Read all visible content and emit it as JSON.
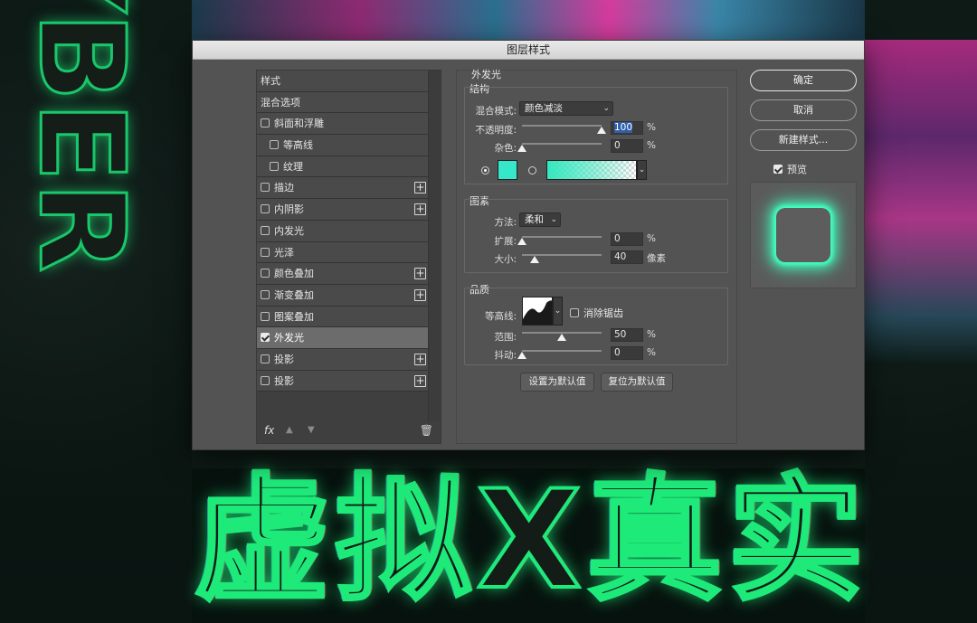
{
  "dialog": {
    "title": "图层样式"
  },
  "left_panel": {
    "items": [
      {
        "label": "样式",
        "type": "header"
      },
      {
        "label": "混合选项",
        "type": "header"
      },
      {
        "label": "斜面和浮雕",
        "type": "check",
        "checked": false,
        "plus": false
      },
      {
        "label": "等高线",
        "type": "subcheck",
        "checked": false,
        "plus": false
      },
      {
        "label": "纹理",
        "type": "subcheck",
        "checked": false,
        "plus": false
      },
      {
        "label": "描边",
        "type": "check",
        "checked": false,
        "plus": true
      },
      {
        "label": "内阴影",
        "type": "check",
        "checked": false,
        "plus": true
      },
      {
        "label": "内发光",
        "type": "check",
        "checked": false,
        "plus": false
      },
      {
        "label": "光泽",
        "type": "check",
        "checked": false,
        "plus": false
      },
      {
        "label": "颜色叠加",
        "type": "check",
        "checked": false,
        "plus": true
      },
      {
        "label": "渐变叠加",
        "type": "check",
        "checked": false,
        "plus": true
      },
      {
        "label": "图案叠加",
        "type": "check",
        "checked": false,
        "plus": false
      },
      {
        "label": "外发光",
        "type": "check",
        "checked": true,
        "plus": false,
        "selected": true
      },
      {
        "label": "投影",
        "type": "check",
        "checked": false,
        "plus": true
      },
      {
        "label": "投影",
        "type": "check",
        "checked": false,
        "plus": true
      }
    ],
    "footer": {
      "fx": "fx"
    }
  },
  "outer_glow": {
    "title": "外发光",
    "structure": {
      "title": "结构",
      "blend_mode_label": "混合模式:",
      "blend_mode_value": "颜色减淡",
      "opacity_label": "不透明度:",
      "opacity_value": "100",
      "opacity_unit": "%",
      "opacity_level": 1.0,
      "noise_label": "杂色:",
      "noise_value": "0",
      "noise_unit": "%",
      "noise_level": 0.0,
      "glow_color": "#34e8c9",
      "color_mode": "solid"
    },
    "elements": {
      "title": "图素",
      "technique_label": "方法:",
      "technique_value": "柔和",
      "spread_label": "扩展:",
      "spread_value": "0",
      "spread_unit": "%",
      "spread_level": 0.0,
      "size_label": "大小:",
      "size_value": "40",
      "size_unit": "像素",
      "size_level": 0.16
    },
    "quality": {
      "title": "品质",
      "contour_label": "等高线:",
      "antialias_label": "消除锯齿",
      "antialias_checked": false,
      "range_label": "范围:",
      "range_value": "50",
      "range_unit": "%",
      "range_level": 0.5,
      "jitter_label": "抖动:",
      "jitter_value": "0",
      "jitter_unit": "%",
      "jitter_level": 0.0
    },
    "buttons": {
      "make_default": "设置为默认值",
      "reset_default": "复位为默认值"
    }
  },
  "right_panel": {
    "ok": "确定",
    "cancel": "取消",
    "new_style": "新建样式...",
    "preview_label": "预览",
    "preview_checked": true,
    "glow_preview_color": "#42ffc0"
  },
  "background": {
    "headline": "虚拟X真实",
    "vertical_text": "CYBER"
  }
}
